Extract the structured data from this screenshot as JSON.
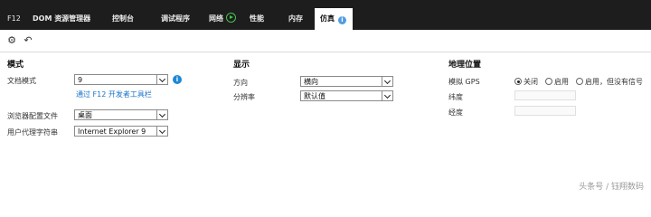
{
  "tabs": {
    "f12": "F12",
    "dom": "DOM 资源管理器",
    "console": "控制台",
    "debugger": "调试程序",
    "network": "网络",
    "performance": "性能",
    "memory": "内存",
    "emulation": "仿真"
  },
  "icons": {
    "settings": "settings-gear-icon",
    "reset": "undo-icon"
  },
  "mode": {
    "title": "模式",
    "document_mode_label": "文档模式",
    "document_mode_value": "9",
    "link": "通过 F12 开发者工具栏",
    "browser_profile_label": "浏览器配置文件",
    "browser_profile_value": "桌面",
    "user_agent_label": "用户代理字符串",
    "user_agent_value": "Internet Explorer 9"
  },
  "display": {
    "title": "显示",
    "orientation_label": "方向",
    "orientation_value": "横向",
    "resolution_label": "分辨率",
    "resolution_value": "默认值"
  },
  "geo": {
    "title": "地理位置",
    "gps_label": "模拟 GPS",
    "option_off": "关闭",
    "option_on": "启用",
    "option_no_signal": "启用，但没有信号",
    "latitude_label": "纬度",
    "longitude_label": "经度"
  },
  "watermark": "头条号 / 钰翔数码",
  "colors": {
    "tab_bar": "#1d1d1d",
    "link": "#1a73c9",
    "info": "#1e88d6",
    "network_play": "#44c44e"
  }
}
